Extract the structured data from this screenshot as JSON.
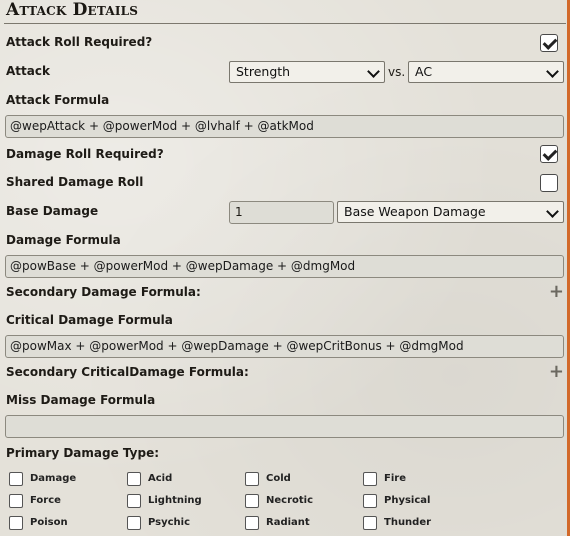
{
  "header": {
    "title": "Attack Details"
  },
  "attack_roll": {
    "label": "Attack Roll Required?",
    "checked": true
  },
  "attack": {
    "label": "Attack",
    "ability": "Strength",
    "vs_label": "vs.",
    "defense": "AC"
  },
  "attack_formula": {
    "label": "Attack Formula",
    "value": "@wepAttack + @powerMod + @lvhalf + @atkMod"
  },
  "damage_roll": {
    "label": "Damage Roll Required?",
    "checked": true
  },
  "shared_damage": {
    "label": "Shared Damage Roll",
    "checked": false
  },
  "base_damage": {
    "label": "Base Damage",
    "dice": "1",
    "type": "Base Weapon Damage"
  },
  "damage_formula": {
    "label": "Damage Formula",
    "value": "@powBase + @powerMod + @wepDamage + @dmgMod"
  },
  "secondary_damage": {
    "label": "Secondary Damage Formula:",
    "icon": "plus-icon"
  },
  "critical_formula": {
    "label": "Critical Damage Formula",
    "value": "@powMax + @powerMod + @wepDamage + @wepCritBonus + @dmgMod"
  },
  "secondary_critical": {
    "label": "Secondary CriticalDamage Formula:",
    "icon": "plus-icon"
  },
  "miss_formula": {
    "label": "Miss Damage Formula",
    "value": ""
  },
  "damage_types": {
    "label": "Primary Damage Type:",
    "items": [
      "Damage",
      "Acid",
      "Cold",
      "Fire",
      "Force",
      "Lightning",
      "Necrotic",
      "Physical",
      "Poison",
      "Psychic",
      "Radiant",
      "Thunder"
    ]
  },
  "colors": {
    "scroll_accent": "#d2692a"
  }
}
